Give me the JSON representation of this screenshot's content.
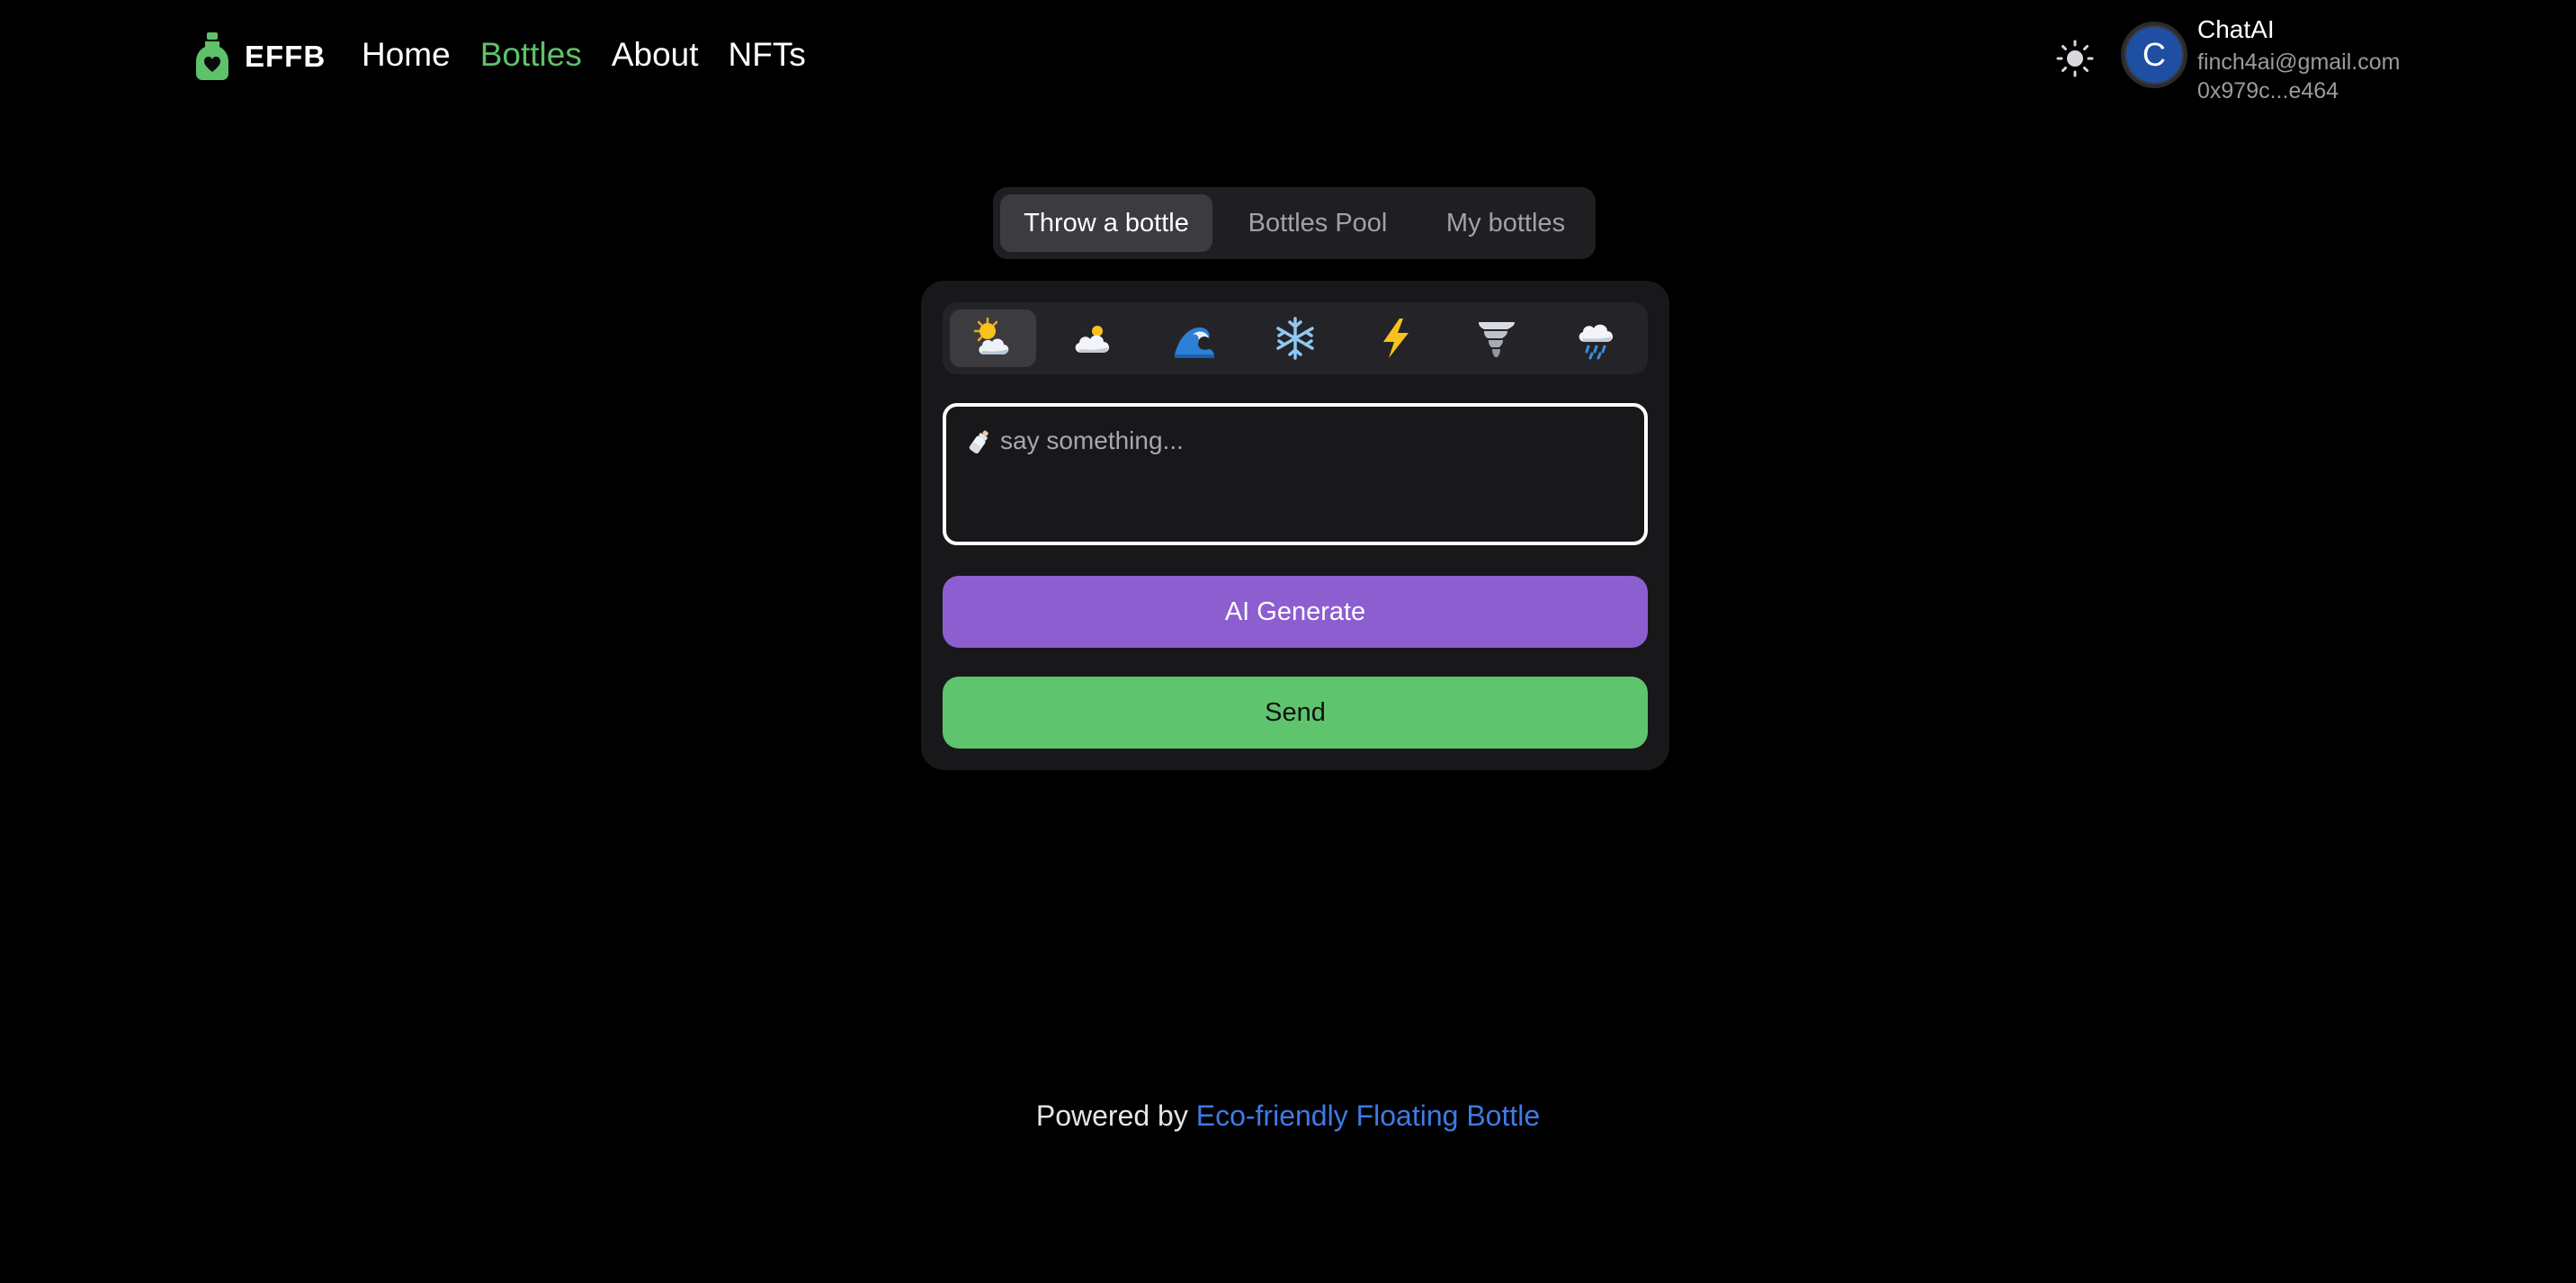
{
  "header": {
    "brand": "EFFB",
    "nav": [
      {
        "label": "Home",
        "active": false
      },
      {
        "label": "Bottles",
        "active": true
      },
      {
        "label": "About",
        "active": false
      },
      {
        "label": "NFTs",
        "active": false
      }
    ],
    "user": {
      "avatar_initial": "C",
      "name": "ChatAI",
      "email": "finch4ai@gmail.com",
      "address": "0x979c...e464"
    }
  },
  "tabs": [
    {
      "label": "Throw a bottle",
      "active": true
    },
    {
      "label": "Bottles Pool",
      "active": false
    },
    {
      "label": "My bottles",
      "active": false
    }
  ],
  "weather_options": [
    {
      "name": "sun-behind-cloud-icon",
      "active": true
    },
    {
      "name": "cloud-icon",
      "active": false
    },
    {
      "name": "wave-icon",
      "active": false
    },
    {
      "name": "snowflake-icon",
      "active": false
    },
    {
      "name": "lightning-icon",
      "active": false
    },
    {
      "name": "tornado-icon",
      "active": false
    },
    {
      "name": "rain-cloud-icon",
      "active": false
    }
  ],
  "composer": {
    "placeholder": "say something...",
    "value": ""
  },
  "buttons": {
    "ai_generate": "AI Generate",
    "send": "Send"
  },
  "footer": {
    "prefix": "Powered by",
    "link": "Eco-friendly Floating Bottle"
  },
  "colors": {
    "accent_green": "#5ec26a",
    "ai_purple": "#8d5ed0",
    "link_blue": "#3f7ae6",
    "avatar_blue": "#1f4fa3"
  }
}
